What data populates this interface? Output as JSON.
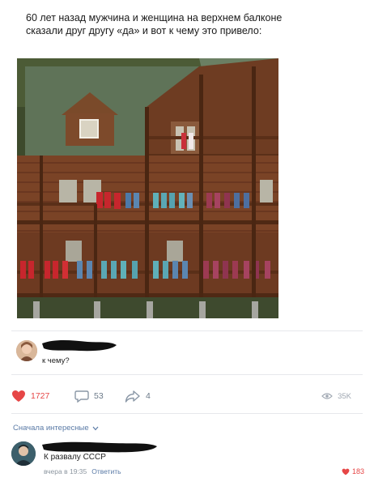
{
  "post": {
    "text": "60 лет назад мужчина и женщина на верхнем балконе сказали друг другу «да» и вот к чему это привело:"
  },
  "comment1": {
    "text": "к чему?"
  },
  "actions": {
    "likes": "1727",
    "comments": "53",
    "shares": "4",
    "views": "35K"
  },
  "sort": {
    "label": "Сначала интересные"
  },
  "comment2": {
    "text": "К развалу СССР",
    "time": "вчера в 19:35",
    "reply": "Ответить",
    "likes": "183"
  },
  "icons": {
    "like": "heart-icon",
    "comment": "comment-bubble-icon",
    "share": "share-arrow-icon",
    "views": "eye-icon",
    "sort": "chevron-down-icon"
  },
  "colors": {
    "accent_red": "#e64646",
    "link_blue": "#5a7aa6",
    "muted": "#8c96a0"
  }
}
